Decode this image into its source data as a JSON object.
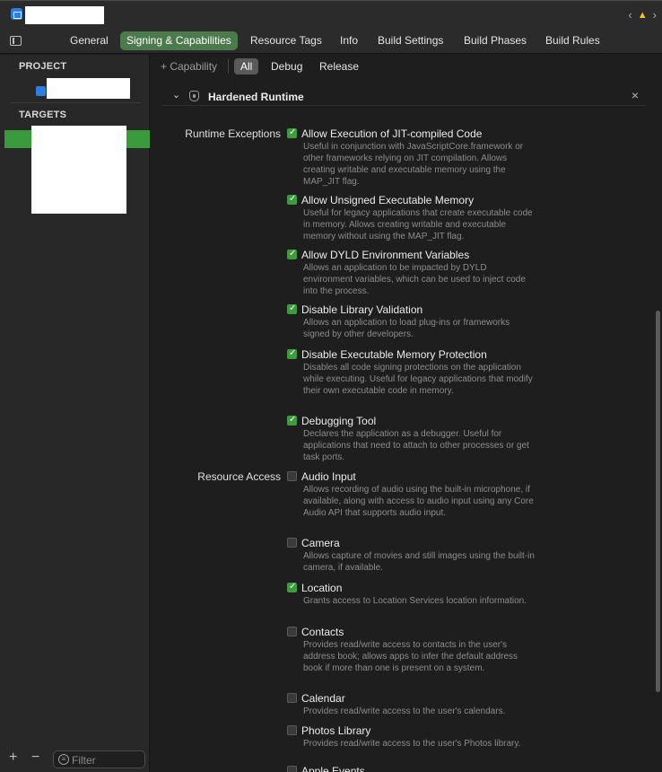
{
  "tabs": [
    "General",
    "Signing & Capabilities",
    "Resource Tags",
    "Info",
    "Build Settings",
    "Build Phases",
    "Build Rules"
  ],
  "active_tab": "Signing & Capabilities",
  "sidebar": {
    "project_header": "PROJECT",
    "targets_header": "TARGETS",
    "filter_placeholder": "Filter",
    "add": "+",
    "remove": "−"
  },
  "configs": {
    "capability_label": "+ Capability",
    "all": "All",
    "debug": "Debug",
    "release": "Release"
  },
  "section": {
    "title": "Hardened Runtime",
    "close": "×",
    "chevron": "⌄"
  },
  "groups": {
    "runtime_exceptions": "Runtime Exceptions",
    "resource_access": "Resource Access"
  },
  "options": [
    {
      "title": "Allow Execution of JIT-compiled Code",
      "checked": true,
      "desc": "Useful in conjunction with JavaScriptCore.framework or other frameworks relying on JIT compilation. Allows creating writable and executable memory using the MAP_JIT flag."
    },
    {
      "title": "Allow Unsigned Executable Memory",
      "checked": true,
      "desc": "Useful for legacy applications that create executable code in memory. Allows creating writable and executable memory without using the MAP_JIT flag."
    },
    {
      "title": "Allow DYLD Environment Variables",
      "checked": true,
      "desc": "Allows an application to be impacted by DYLD environment variables, which can be used to inject code into the process."
    },
    {
      "title": "Disable Library Validation",
      "checked": true,
      "desc": "Allows an application to load plug-ins or frameworks signed by other developers."
    },
    {
      "title": "Disable Executable Memory Protection",
      "checked": true,
      "desc": "Disables all code signing protections on the application while executing. Useful for legacy applications that modify their own executable code in memory."
    },
    {
      "title": "Debugging Tool",
      "checked": true,
      "desc": "Declares the application as a debugger. Useful for applications that need to attach to other processes or get task ports."
    },
    {
      "title": "Audio Input",
      "checked": false,
      "desc": "Allows recording of audio using the built-in microphone, if available, along with access to audio input using any Core Audio API that supports audio input."
    },
    {
      "title": "Camera",
      "checked": false,
      "desc": "Allows capture of movies and still images using the built-in camera, if available."
    },
    {
      "title": "Location",
      "checked": true,
      "desc": "Grants access to Location Services location information."
    },
    {
      "title": "Contacts",
      "checked": false,
      "desc": "Provides read/write access to contacts in the user's address book; allows apps to infer the default address book if more than one is present on a system."
    },
    {
      "title": "Calendar",
      "checked": false,
      "desc": "Provides read/write access to the user's calendars."
    },
    {
      "title": "Photos Library",
      "checked": false,
      "desc": "Provides read/write access to the user's Photos library."
    },
    {
      "title": "Apple Events",
      "checked": false,
      "desc": ""
    }
  ],
  "colors": {
    "accent_green": "#3e9b3e",
    "active_tab": "#4c7a4c",
    "warning": "#f4c430"
  }
}
